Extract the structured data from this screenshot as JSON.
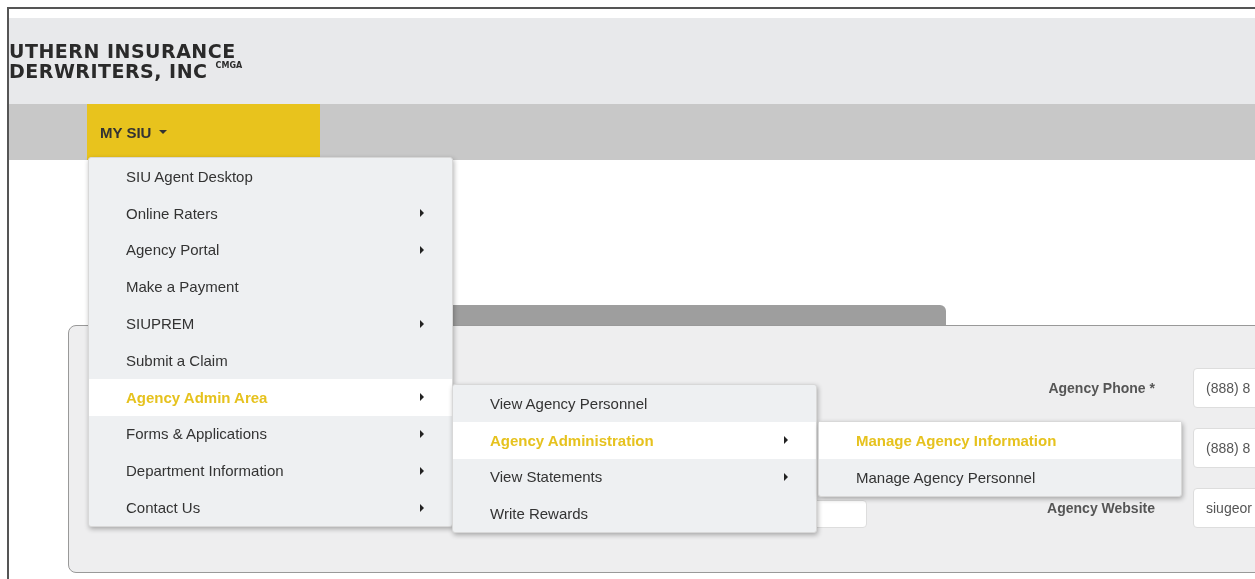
{
  "logo": {
    "line_1": "UTHERN INSURANCE",
    "line_2": "DERWRITERS, INC",
    "suffix": "CMGA"
  },
  "nav": [
    {
      "label": "MY SIU",
      "selected": true
    }
  ],
  "menus": [
    {
      "items": [
        {
          "label": "SIU Agent Desktop",
          "submenu": false,
          "selected": false
        },
        {
          "label": "Online Raters",
          "submenu": true,
          "selected": false
        },
        {
          "label": "Agency Portal",
          "submenu": true,
          "selected": false
        },
        {
          "label": "Make a Payment",
          "submenu": false,
          "selected": false
        },
        {
          "label": "SIUPREM",
          "submenu": true,
          "selected": false
        },
        {
          "label": "Submit a Claim",
          "submenu": false,
          "selected": false
        },
        {
          "label": "Agency Admin Area",
          "submenu": true,
          "selected": true
        },
        {
          "label": "Forms & Applications",
          "submenu": true,
          "selected": false
        },
        {
          "label": "Department Information",
          "submenu": true,
          "selected": false
        },
        {
          "label": "Contact Us",
          "submenu": true,
          "selected": false
        }
      ]
    },
    {
      "items": [
        {
          "label": "View Agency Personnel",
          "submenu": false,
          "selected": false
        },
        {
          "label": "Agency Administration",
          "submenu": true,
          "selected": true
        },
        {
          "label": "View Statements",
          "submenu": true,
          "selected": false
        },
        {
          "label": "Write Rewards",
          "submenu": false,
          "selected": false
        }
      ]
    },
    {
      "items": [
        {
          "label": "Manage Agency Information",
          "submenu": false,
          "selected": true
        },
        {
          "label": "Manage Agency Personnel",
          "submenu": false,
          "selected": false
        }
      ]
    }
  ],
  "form": {
    "fields": [
      {
        "label": "Agency Phone *",
        "value": "(888) 8"
      },
      {
        "value": "(888) 8"
      },
      {
        "label": "Agency Website",
        "value": "siugeor"
      }
    ]
  }
}
